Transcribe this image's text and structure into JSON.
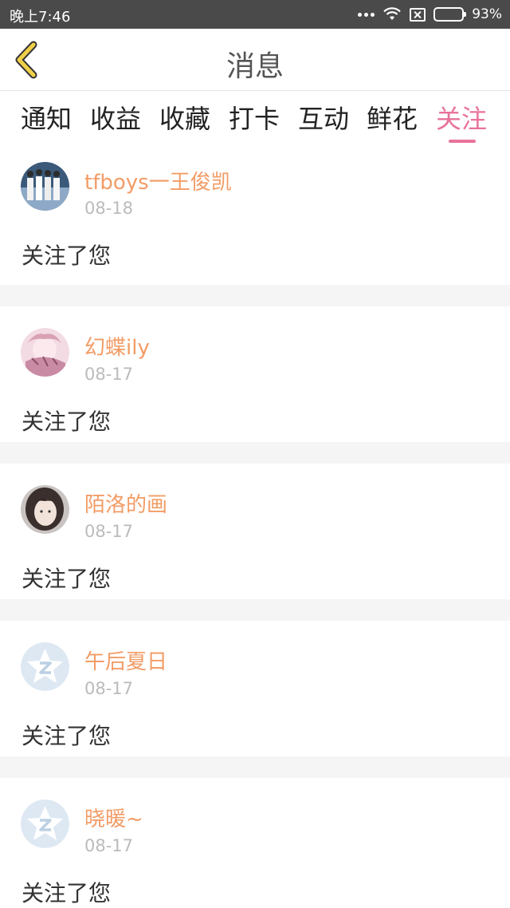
{
  "status_bar": {
    "time": "晚上7:46",
    "battery": "93%",
    "battery_level": 0.93
  },
  "header": {
    "title": "消息",
    "back_icon": "chevron-left-icon"
  },
  "tabs": [
    {
      "label": "通知",
      "active": false
    },
    {
      "label": "收益",
      "active": false
    },
    {
      "label": "收藏",
      "active": false
    },
    {
      "label": "打卡",
      "active": false
    },
    {
      "label": "互动",
      "active": false
    },
    {
      "label": "鲜花",
      "active": false
    },
    {
      "label": "关注",
      "active": true
    }
  ],
  "colors": {
    "accent": "#e8739a",
    "username": "#f29c66",
    "back_arrow": "#f0d04a"
  },
  "notifications": [
    {
      "username": "tfboys一王俊凯",
      "date": "08-18",
      "message": "关注了您",
      "avatar": "photo-group-avatar"
    },
    {
      "username": "幻蝶ily",
      "date": "08-17",
      "message": "关注了您",
      "avatar": "anime-avatar"
    },
    {
      "username": "陌洛的画",
      "date": "08-17",
      "message": "关注了您",
      "avatar": "portrait-avatar"
    },
    {
      "username": "午后夏日",
      "date": "08-17",
      "message": "关注了您",
      "avatar": "default-star-avatar"
    },
    {
      "username": "晓暖~",
      "date": "08-17",
      "message": "关注了您",
      "avatar": "default-star-avatar"
    }
  ]
}
